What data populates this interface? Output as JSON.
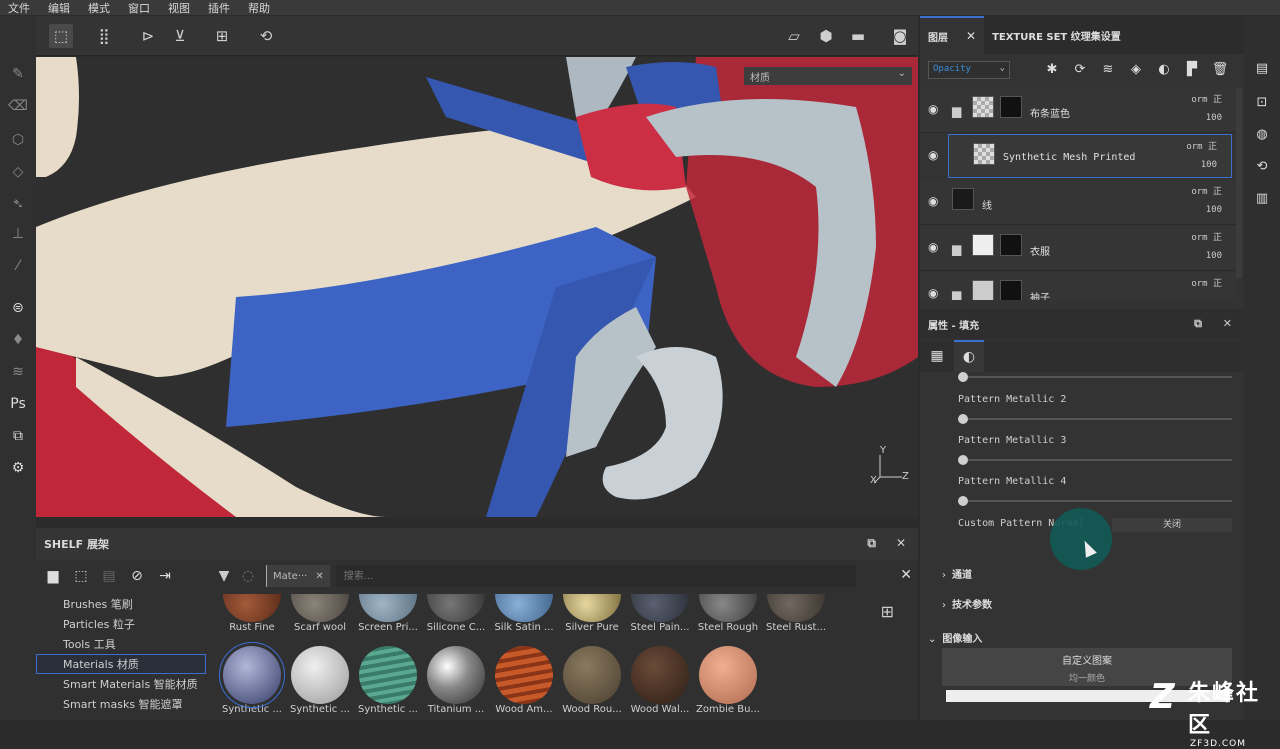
{
  "menubar": [
    "文件",
    "编辑",
    "模式",
    "窗口",
    "视图",
    "插件",
    "帮助"
  ],
  "viewport": {
    "dropdown_label": "材质",
    "axis": {
      "y": "Y",
      "x": "X",
      "z": "Z"
    }
  },
  "shelf": {
    "title": "SHELF 展架",
    "categories": [
      {
        "label": "Brushes 笔刷",
        "selected": false
      },
      {
        "label": "Particles 粒子",
        "selected": false
      },
      {
        "label": "Tools 工具",
        "selected": false
      },
      {
        "label": "Materials 材质",
        "selected": true
      },
      {
        "label": "Smart Materials 智能材质",
        "selected": false
      },
      {
        "label": "Smart masks 智能遮罩",
        "selected": false
      }
    ],
    "filter_tag": "Mate···",
    "search_placeholder": "搜索...",
    "materials_row1": [
      "Rust Fine",
      "Scarf wool",
      "Screen Pri...",
      "Silicone C...",
      "Silk Satin ...",
      "Silver Pure",
      "Steel Pain...",
      "Steel Rough",
      "Steel Rust..."
    ],
    "materials_row2": [
      "Synthetic ...",
      "Synthetic ...",
      "Synthetic ...",
      "Titanium ...",
      "Wood Am...",
      "Wood Rou...",
      "Wood Wal...",
      "Zombie Bu..."
    ]
  },
  "layers_panel": {
    "tabs": [
      {
        "label": "图层",
        "active": true
      },
      {
        "label": "TEXTURE SET 纹理集设置",
        "active": false
      }
    ],
    "blend_mode": "Opacity",
    "layers": [
      {
        "name": "布条蓝色",
        "mode": "orm 正",
        "opacity": "100",
        "folder": true,
        "selected": false
      },
      {
        "name": "Synthetic Mesh Printed",
        "mode": "orm 正",
        "opacity": "100",
        "folder": false,
        "selected": true
      },
      {
        "name": "线",
        "mode": "orm 正",
        "opacity": "100",
        "folder": false,
        "selected": false
      },
      {
        "name": "衣服",
        "mode": "orm 正",
        "opacity": "100",
        "folder": true,
        "selected": false
      },
      {
        "name": "袖子",
        "mode": "orm 正",
        "opacity": "",
        "folder": true,
        "selected": false
      }
    ]
  },
  "properties": {
    "title": "属性 - 填充",
    "sliders": [
      {
        "label": "Pattern Metallic 2",
        "value": 0
      },
      {
        "label": "Pattern Metallic 3",
        "value": 0
      },
      {
        "label": "Pattern Metallic 4",
        "value": 0
      }
    ],
    "custom_normal": {
      "label": "Custom Pattern Normal",
      "value": "关闭"
    },
    "sections": [
      "通道",
      "技术参数",
      "图像输入"
    ],
    "image_input": {
      "title": "自定义图案",
      "subtitle": "均一颜色"
    }
  },
  "watermark": {
    "brand": "朱峰社区",
    "site": "ZF3D.COM"
  }
}
